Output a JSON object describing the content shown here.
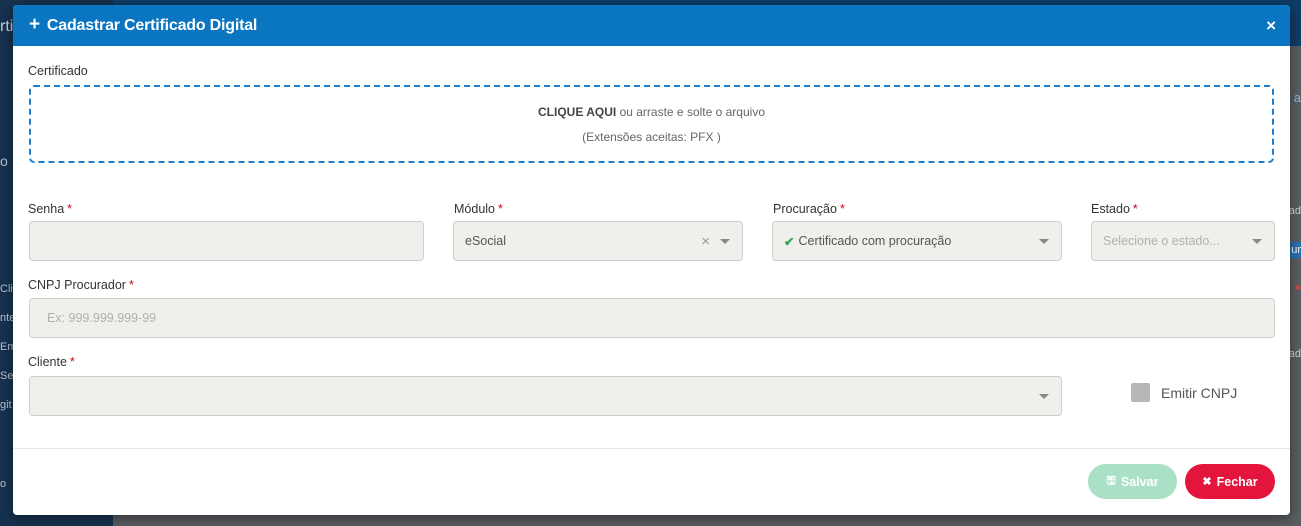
{
  "modal": {
    "title": "Cadastrar Certificado Digital",
    "close_symbol": "×"
  },
  "certificate": {
    "label": "Certificado",
    "dropzone_action": "CLIQUE AQUI",
    "dropzone_text": " ou arraste e solte o arquivo",
    "dropzone_hint": "(Extensões aceitas: PFX )"
  },
  "fields": {
    "senha": {
      "label": "Senha",
      "value": ""
    },
    "modulo": {
      "label": "Módulo",
      "value": "eSocial"
    },
    "procuracao": {
      "label": "Procuração",
      "value": "Certificado com procuração"
    },
    "estado": {
      "label": "Estado",
      "placeholder": "Selecione o estado..."
    },
    "cnpj_procurador": {
      "label": "CNPJ Procurador",
      "placeholder": "Ex: 999.999.999-99"
    },
    "cliente": {
      "label": "Cliente",
      "value": ""
    }
  },
  "emitir_cnpj": {
    "label": "Emitir CNPJ",
    "checked": false
  },
  "required_marker": "*",
  "buttons": {
    "save": "Salvar",
    "close": "Fechar"
  },
  "background": {
    "side_items": [
      "rti",
      "o",
      "Cli",
      "nte",
      "Em",
      "Se",
      "git",
      "o"
    ],
    "right_items": [
      "ad",
      "a",
      "ur",
      "×",
      "ad"
    ]
  },
  "colors": {
    "header": "#0a76c2",
    "save_button": "#a9e0c6",
    "close_button": "#e4153d",
    "dropzone_border": "#1a7fd1"
  }
}
